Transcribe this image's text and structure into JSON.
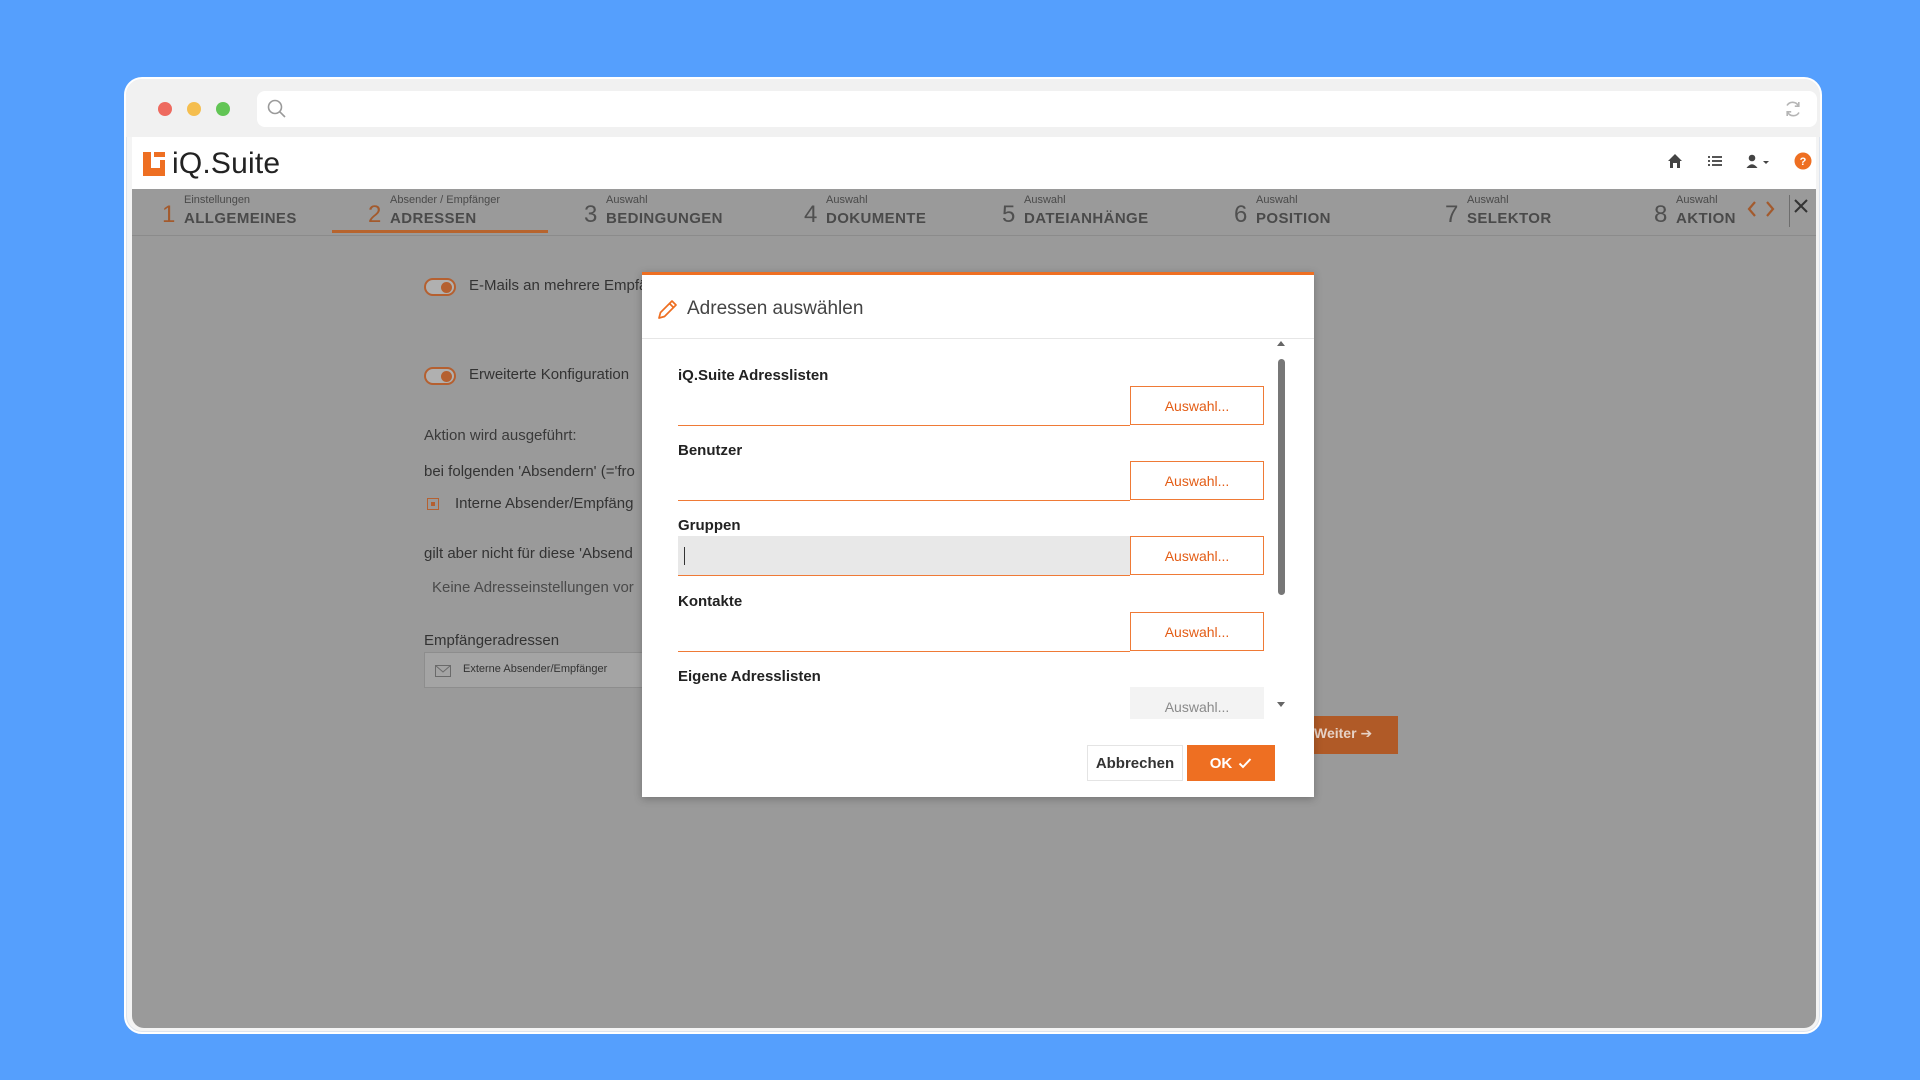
{
  "app": {
    "name": "iQ.Suite"
  },
  "colors": {
    "accent": "#ee6f22",
    "background": "#559ffd"
  },
  "steps": [
    {
      "num": "1",
      "sub": "Einstellungen",
      "label": "ALLGEMEINES"
    },
    {
      "num": "2",
      "sub": "Absender / Empfänger",
      "label": "ADRESSEN"
    },
    {
      "num": "3",
      "sub": "Auswahl",
      "label": "BEDINGUNGEN"
    },
    {
      "num": "4",
      "sub": "Auswahl",
      "label": "DOKUMENTE"
    },
    {
      "num": "5",
      "sub": "Auswahl",
      "label": "DATEIANHÄNGE"
    },
    {
      "num": "6",
      "sub": "Auswahl",
      "label": "POSITION"
    },
    {
      "num": "7",
      "sub": "Auswahl",
      "label": "SELEKTOR"
    },
    {
      "num": "8",
      "sub": "Auswahl",
      "label": "AKTION"
    }
  ],
  "background_form": {
    "toggle_multi": "E-Mails an mehrere Empfä",
    "toggle_extended": "Erweiterte Konfiguration",
    "action_heading": "Aktion wird ausgeführt:",
    "senders_line": "bei folgenden 'Absendern' (='fro",
    "internal_sender": "Interne Absender/Empfäng",
    "except_line": "gilt aber nicht für diese 'Absend",
    "no_address": "Keine Adresseinstellungen vor",
    "recipients_label": "Empfängeradressen",
    "recipient_chip": "Externe Absender/Empfänger",
    "next_button": "Weiter"
  },
  "modal": {
    "title": "Adressen auswählen",
    "fields": [
      {
        "label": "iQ.Suite Adresslisten",
        "value": "",
        "button": "Auswahl..."
      },
      {
        "label": "Benutzer",
        "value": "",
        "button": "Auswahl..."
      },
      {
        "label": "Gruppen",
        "value": "",
        "button": "Auswahl..."
      },
      {
        "label": "Kontakte",
        "value": "",
        "button": "Auswahl..."
      },
      {
        "label": "Eigene Adresslisten",
        "value": "",
        "button": "Auswahl..."
      }
    ],
    "cancel": "Abbrechen",
    "ok": "OK"
  }
}
